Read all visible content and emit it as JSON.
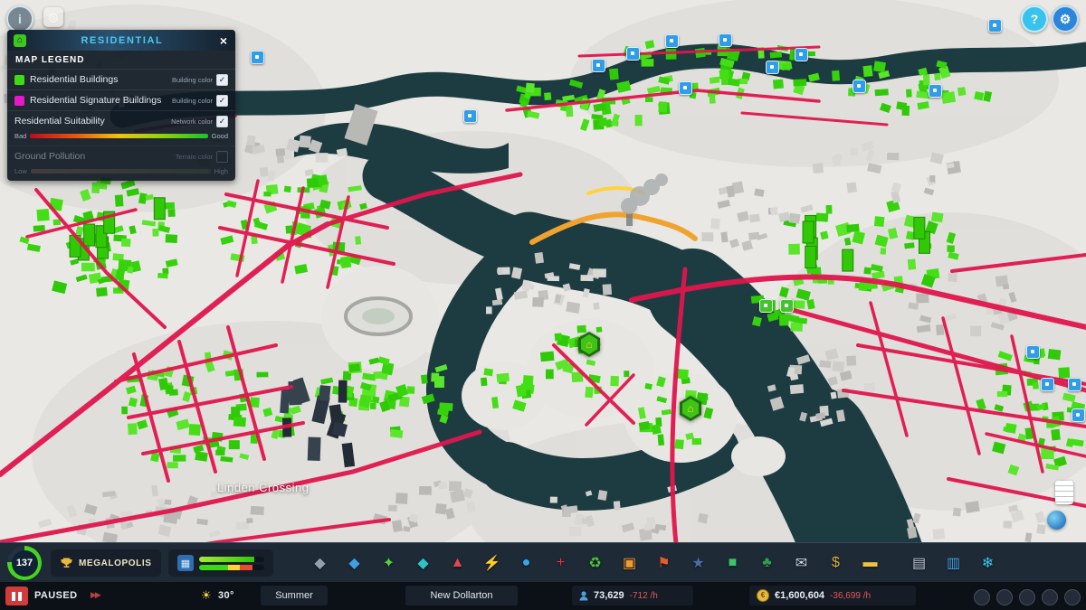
{
  "topbar": {
    "info_glyph": "i",
    "hidden_glyph": "◎",
    "help_glyph": "?",
    "settings_glyph": "⚙"
  },
  "panel": {
    "icon_glyph": "⌂",
    "title": "RESIDENTIAL",
    "close_glyph": "×",
    "legend_title": "MAP LEGEND",
    "rows": [
      {
        "label": "Residential Buildings",
        "toggle": "Building color",
        "swatch": "#3edc12",
        "check": "✓"
      },
      {
        "label": "Residential Signature Buildings",
        "toggle": "Building color",
        "swatch": "#e519c9",
        "check": "✓"
      },
      {
        "label": "Residential Suitability",
        "toggle": "Network color",
        "left": "Bad",
        "right": "Good",
        "check": "✓"
      },
      {
        "label": "Ground Pollution",
        "toggle": "Terrain color",
        "left": "Low",
        "right": "High",
        "check": ""
      }
    ]
  },
  "map": {
    "district_label": "Linden Crossing",
    "hex_glyph": "⌂"
  },
  "toolbar": {
    "level": "137",
    "milestone": "MEGALOPOLIS",
    "demand_glyph": "▦",
    "icons": [
      {
        "name": "zoning",
        "glyph": "◆",
        "color": "#93a0ae"
      },
      {
        "name": "areas",
        "glyph": "◆",
        "color": "#3f9fe0"
      },
      {
        "name": "vegetation",
        "glyph": "✦",
        "color": "#55d238"
      },
      {
        "name": "roads",
        "glyph": "◆",
        "color": "#2fc0c8"
      },
      {
        "name": "terraforming",
        "glyph": "▲",
        "color": "#e0484e"
      },
      {
        "name": "electricity",
        "glyph": "⚡",
        "color": "#ffd33c"
      },
      {
        "name": "water-sewage",
        "glyph": "●",
        "color": "#38a6e8"
      },
      {
        "name": "healthcare",
        "glyph": "+",
        "color": "#e83048"
      },
      {
        "name": "garbage",
        "glyph": "♻",
        "color": "#48cc34"
      },
      {
        "name": "education",
        "glyph": "▣",
        "color": "#f09a30"
      },
      {
        "name": "fire-rescue",
        "glyph": "⚑",
        "color": "#e85a2e"
      },
      {
        "name": "police",
        "glyph": "★",
        "color": "#4a6ea8"
      },
      {
        "name": "transportation",
        "glyph": "■",
        "color": "#3cc46a"
      },
      {
        "name": "parks-recreation",
        "glyph": "♣",
        "color": "#2f9e50"
      },
      {
        "name": "communications",
        "glyph": "✉",
        "color": "#c8d4de"
      },
      {
        "name": "economy",
        "glyph": "$",
        "color": "#d4ab3e"
      },
      {
        "name": "bulldozer",
        "glyph": "▬",
        "color": "#f0c23c"
      }
    ],
    "right_icons": [
      {
        "name": "production",
        "glyph": "▤",
        "color": "#b8c4d0"
      },
      {
        "name": "statistics",
        "glyph": "▥",
        "color": "#3f9fe0"
      },
      {
        "name": "climate",
        "glyph": "❄",
        "color": "#3ec8ee"
      }
    ]
  },
  "statusbar": {
    "paused_label": "PAUSED",
    "speed_glyph": "▶▶",
    "sun_glyph": "☀",
    "temperature": "30°",
    "season": "Summer",
    "city_name": "New Dollarton",
    "population": "73,629",
    "population_rate": "-712 /h",
    "money": "€1,600,604",
    "money_rate": "-36,699 /h"
  }
}
